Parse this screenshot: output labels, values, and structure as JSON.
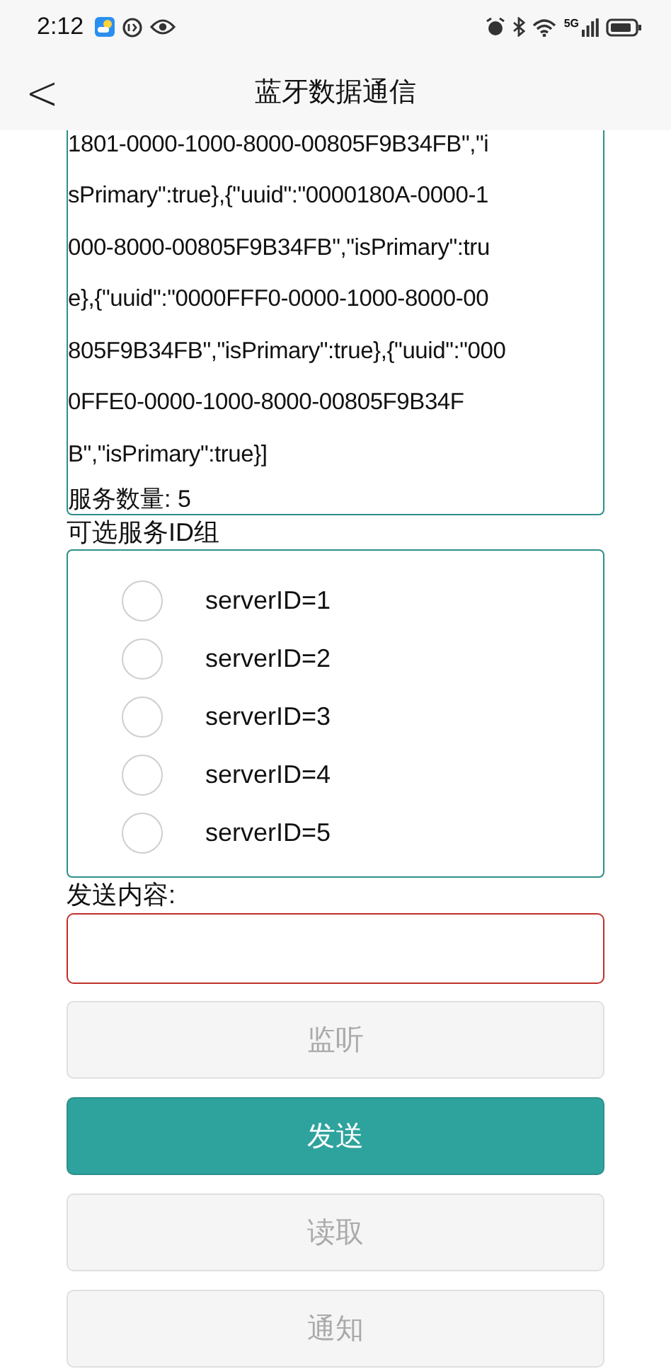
{
  "status_bar": {
    "time": "2:12",
    "network": "5G"
  },
  "header": {
    "back": "<",
    "title": "蓝牙数据通信"
  },
  "services_box": {
    "lines": [
      "1801-0000-1000-8000-00805F9B34FB\",\"i",
      "sPrimary\":true},{\"uuid\":\"0000180A-0000-1",
      "000-8000-00805F9B34FB\",\"isPrimary\":tru",
      "e},{\"uuid\":\"0000FFF0-0000-1000-8000-00",
      "805F9B34FB\",\"isPrimary\":true},{\"uuid\":\"000",
      "0FFE0-0000-1000-8000-00805F9B34F",
      "B\",\"isPrimary\":true}]"
    ],
    "count": "服务数量: 5"
  },
  "service_group": {
    "label": "可选服务ID组",
    "options": [
      {
        "label": "serverID=1",
        "selected": false
      },
      {
        "label": "serverID=2",
        "selected": false
      },
      {
        "label": "serverID=3",
        "selected": false
      },
      {
        "label": "serverID=4",
        "selected": false
      },
      {
        "label": "serverID=5",
        "selected": false
      }
    ]
  },
  "send_field": {
    "label": "发送内容:"
  },
  "buttons": [
    {
      "label": "监听",
      "disabled": true
    },
    {
      "label": "发送",
      "disabled": false
    },
    {
      "label": "读取",
      "disabled": true
    },
    {
      "label": "通知",
      "disabled": true
    }
  ]
}
